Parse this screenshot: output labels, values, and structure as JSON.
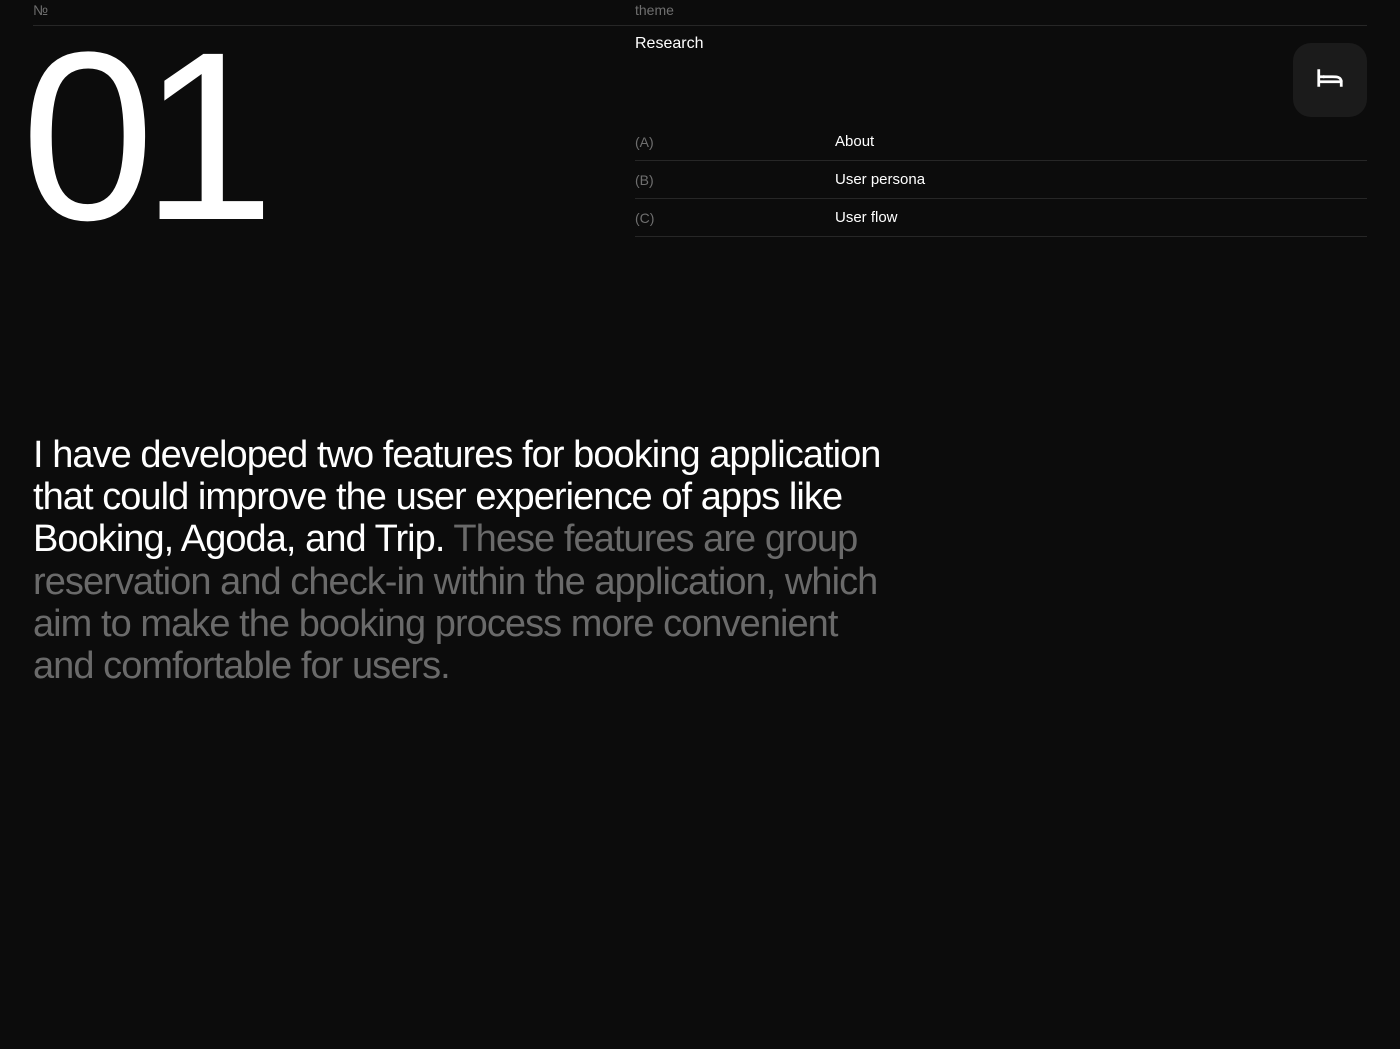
{
  "header": {
    "number_label": "№",
    "theme_label": "theme"
  },
  "section": {
    "number": "01",
    "theme": "Research"
  },
  "toc": [
    {
      "key": "(A)",
      "label": "About"
    },
    {
      "key": "(B)",
      "label": "User persona"
    },
    {
      "key": "(C)",
      "label": "User flow"
    }
  ],
  "icon": {
    "name": "bed-icon"
  },
  "body": {
    "primary": "I have developed two features for booking application that could improve the user experience of apps like Booking, Agoda, and Trip.",
    "secondary": "These features are group reservation and check-in within the application, which aim to make the booking process more convenient and comfortable for users."
  }
}
